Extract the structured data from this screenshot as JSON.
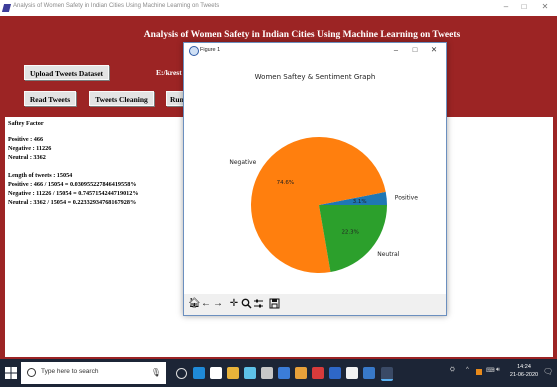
{
  "window": {
    "title": "Analysis of Women Safety in Indian Cities Using Machine Learning on Tweets",
    "minimize": "–",
    "maximize": "□",
    "close": "✕"
  },
  "app": {
    "heading": "Analysis of Women Safety in Indian Cities Using Machine Learning on Tweets",
    "path_label": "E:/krest",
    "buttons": {
      "upload": "Upload Tweets Dataset",
      "read": "Read Tweets",
      "clean": "Tweets Cleaning",
      "run": "Run"
    },
    "colors": {
      "background": "#9c2424",
      "text_area": "#ffffff"
    },
    "output": [
      "Saftey Factor",
      "Positive : 466",
      "Negative : 11226",
      "Neutral : 3362",
      "Length of tweets  : 15054",
      "Positive : 466 / 15054 = 0.030955227846419558%",
      "Negative : 11226 / 15054 = 0.7457154244719012%",
      "Neutral : 3362 / 15054 = 0.22332934768167928%"
    ]
  },
  "figure": {
    "window_title": "Figure 1",
    "minimize": "–",
    "maximize": "□",
    "close": "✕",
    "toolbar_icons": [
      "home-icon",
      "back-arrow-icon",
      "forward-arrow-icon",
      "pan-icon",
      "zoom-icon",
      "configure-subplots-icon",
      "save-icon"
    ]
  },
  "chart_data": {
    "type": "pie",
    "title": "Women Saftey & Sentiment Graph",
    "labels": [
      "Positive",
      "Negative",
      "Neutral"
    ],
    "values": [
      3.1,
      74.6,
      22.3
    ],
    "pct_labels": [
      "3.1%",
      "74.6%",
      "22.3%"
    ],
    "colors": [
      "#1f77b4",
      "#ff7f0e",
      "#2ca02c"
    ],
    "startangle": 0
  },
  "taskbar": {
    "search_placeholder": "Type here to search",
    "time": "14:24",
    "date": "21-06-2020"
  }
}
